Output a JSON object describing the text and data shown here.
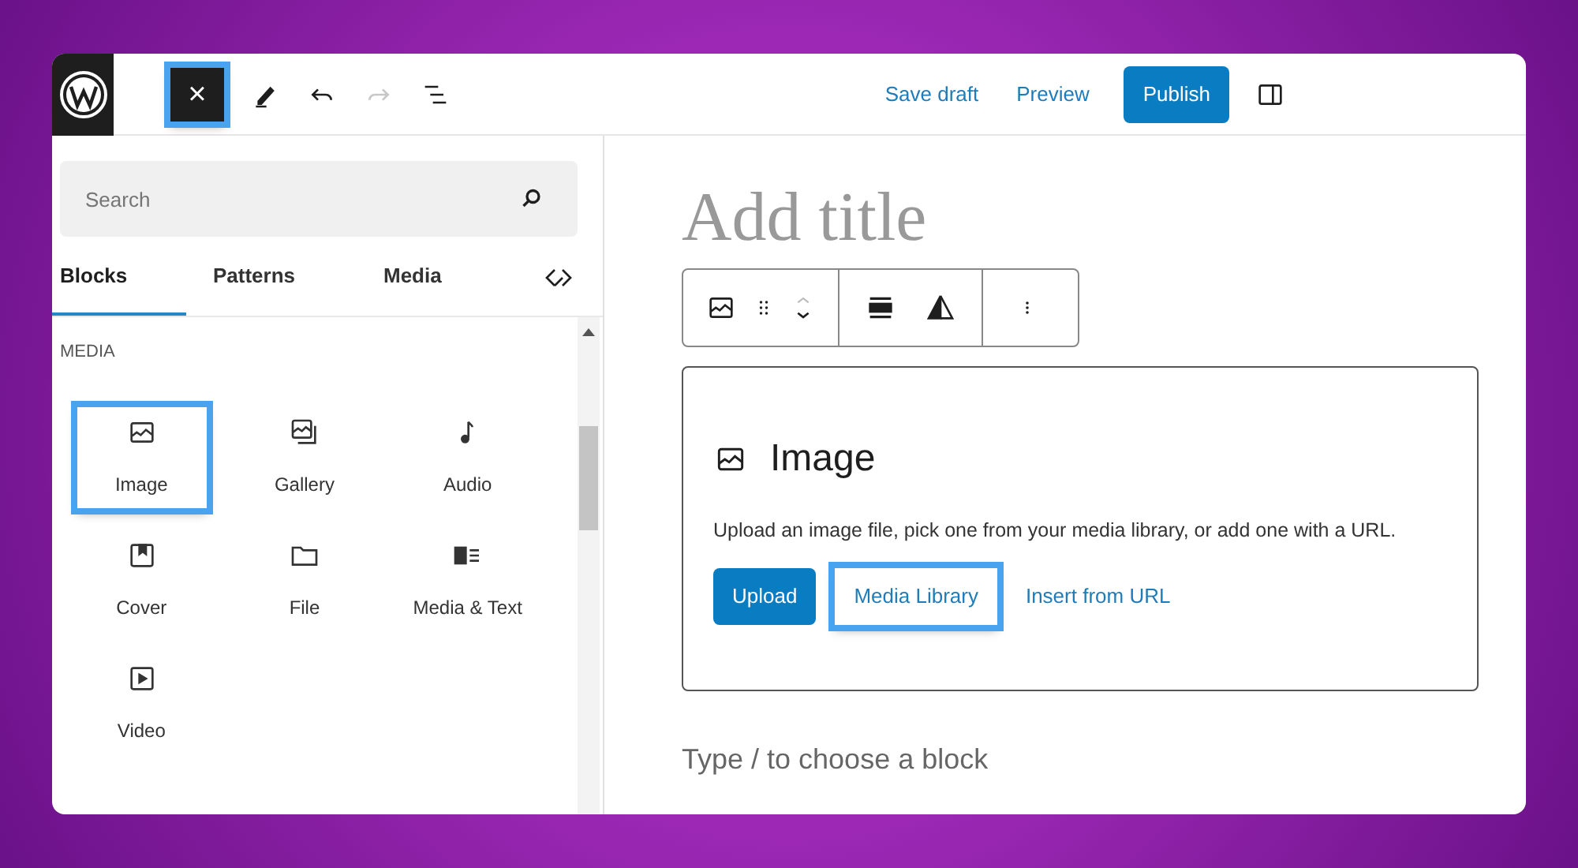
{
  "header": {
    "close_button": {
      "label": "×",
      "highlighted": true
    },
    "actions": [
      {
        "kind": "link",
        "label": "Save draft"
      },
      {
        "kind": "link",
        "label": "Preview"
      },
      {
        "kind": "primary",
        "label": "Publish"
      }
    ]
  },
  "sidebar": {
    "search": {
      "placeholder": "Search"
    },
    "tabs": [
      {
        "label": "Blocks",
        "selected": true
      },
      {
        "label": "Patterns",
        "selected": false
      },
      {
        "label": "Media",
        "selected": false
      }
    ],
    "section_title": "MEDIA",
    "blocks": [
      {
        "kind": "image",
        "label": "Image",
        "highlighted": true
      },
      {
        "kind": "gallery",
        "label": "Gallery",
        "highlighted": false
      },
      {
        "kind": "audio",
        "label": "Audio",
        "highlighted": false
      },
      {
        "kind": "cover",
        "label": "Cover",
        "highlighted": false
      },
      {
        "kind": "file",
        "label": "File",
        "highlighted": false
      },
      {
        "kind": "media-text",
        "label": "Media & Text",
        "highlighted": false
      },
      {
        "kind": "video",
        "label": "Video",
        "highlighted": false
      }
    ]
  },
  "editor": {
    "title_placeholder": "Add title",
    "image_block": {
      "title": "Image",
      "description": "Upload an image file, pick one from your media library, or add one with a URL.",
      "buttons": [
        {
          "kind": "primary",
          "label": "Upload",
          "highlighted": false
        },
        {
          "kind": "link",
          "label": "Media Library",
          "highlighted": true
        },
        {
          "kind": "link",
          "label": "Insert from URL",
          "highlighted": false
        }
      ]
    },
    "block_placeholder": "Type / to choose a block"
  }
}
